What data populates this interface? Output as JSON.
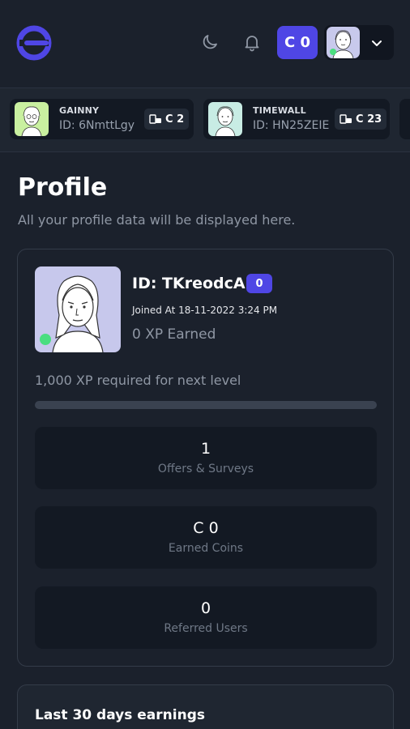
{
  "header": {
    "coin_label": "C 0"
  },
  "ticker": [
    {
      "name": "GAINNY",
      "id": "ID: 6NmttLgy",
      "coins": "C 2",
      "avatar_bg": "#c9f0a0"
    },
    {
      "name": "TIMEWALL",
      "id": "ID: HN25ZEIE",
      "coins": "C 23",
      "avatar_bg": "#c8ece4"
    }
  ],
  "page": {
    "title": "Profile",
    "subtitle": "All your profile data will be displayed here."
  },
  "profile": {
    "id": "ID: TKreodcA",
    "level": "0",
    "joined": "Joined At 18-11-2022 3:24 PM",
    "xp": "0 XP Earned",
    "xp_required": "1,000 XP required for next level",
    "progress_fraction": 0
  },
  "stats": [
    {
      "value": "1",
      "label": "Offers & Surveys"
    },
    {
      "value": "C 0",
      "label": "Earned Coins"
    },
    {
      "value": "0",
      "label": "Referred Users"
    }
  ],
  "earnings": {
    "title": "Last 30 days earnings"
  },
  "colors": {
    "accent": "#4f46e5",
    "online": "#4ade80",
    "background": "#1b212c",
    "card": "#131923"
  },
  "icons": [
    "logo-icon",
    "moon-icon",
    "bell-icon",
    "chevron-down-icon",
    "coins-icon"
  ]
}
